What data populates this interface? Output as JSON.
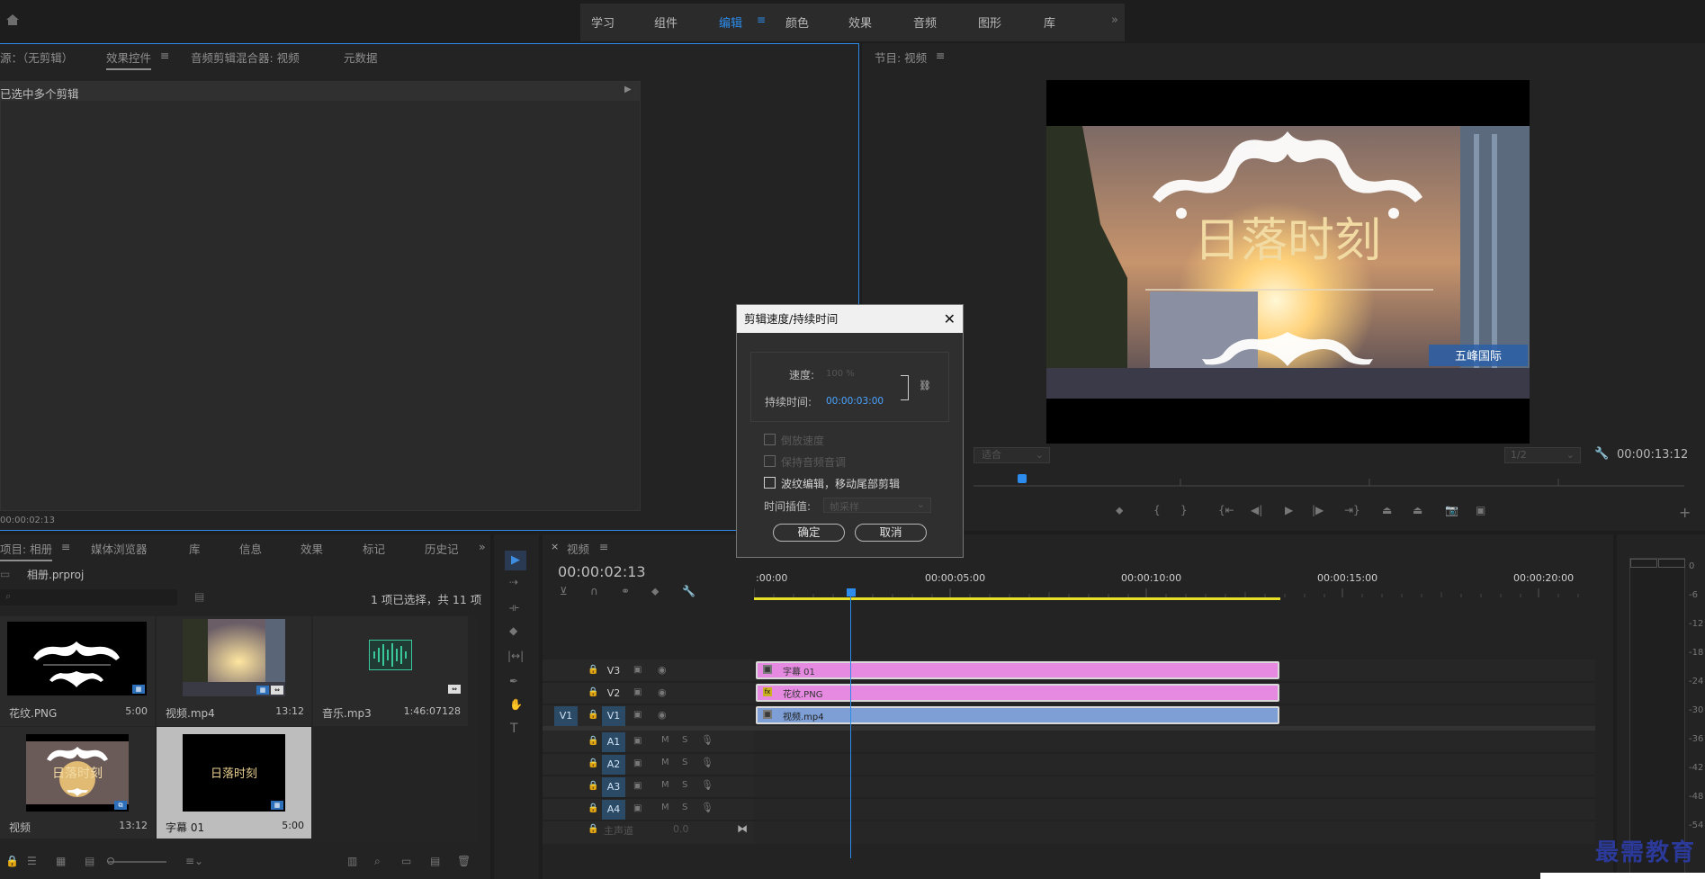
{
  "workspaces": [
    "学习",
    "组件",
    "编辑",
    "颜色",
    "效果",
    "音频",
    "图形",
    "库"
  ],
  "workspace_active_index": 2,
  "source_panel": {
    "tabs": [
      "源：（无剪辑）",
      "效果控件",
      "音频剪辑混合器: 视频",
      "元数据"
    ],
    "selected_message": "已选中多个剪辑",
    "timecode": "00:00:02:13"
  },
  "program_monitor": {
    "tab": "节目: 视频",
    "fit_label": "适合",
    "resolution": "1/2",
    "timecode": "00:00:13:12",
    "title_text": "日落时刻",
    "sign_text": "五峰国际"
  },
  "project_panel": {
    "tabs": [
      "项目: 相册",
      "媒体浏览器",
      "库",
      "信息",
      "效果",
      "标记",
      "历史记"
    ],
    "project_file": "相册.prproj",
    "selection_info": "1 项已选择，共 11 项",
    "items": [
      {
        "name": "花纹.PNG",
        "duration": "5:00",
        "thumb": "ornament"
      },
      {
        "name": "视频.mp4",
        "duration": "13:12",
        "thumb": "sunset"
      },
      {
        "name": "音乐.mp3",
        "duration": "1:46:07128",
        "thumb": "audio"
      },
      {
        "name": "视频",
        "duration": "13:12",
        "thumb": "sequence"
      },
      {
        "name": "字幕 01",
        "duration": "5:00",
        "thumb": "caption"
      }
    ],
    "caption_thumb_text": "日落时刻",
    "sequence_thumb_text": "日落时刻"
  },
  "timeline": {
    "tab": "视频",
    "timecode": "00:00:02:13",
    "ruler": [
      ":00:00",
      "00:00:05:00",
      "00:00:10:00",
      "00:00:15:00",
      "00:00:20:00"
    ],
    "video_tracks": [
      "V3",
      "V2",
      "V1"
    ],
    "audio_tracks": [
      "A1",
      "A2",
      "A3",
      "A4"
    ],
    "source_patch": "V1",
    "master": "主声道",
    "master_value": "0.0",
    "mute_label": "M",
    "solo_label": "S",
    "clips": [
      {
        "track": "V3",
        "name": "字幕 01",
        "color": "#e58ae0"
      },
      {
        "track": "V2",
        "name": "花纹.PNG",
        "color": "#e58ae0"
      },
      {
        "track": "V1",
        "name": "视频.mp4",
        "color": "#7d9fd6"
      }
    ]
  },
  "meter_labels": [
    "0",
    "-6",
    "-12",
    "-18",
    "-24",
    "-30",
    "-36",
    "-42",
    "-48",
    "-54"
  ],
  "dialog": {
    "title": "剪辑速度/持续时间",
    "speed_label": "速度:",
    "speed_value": "100 %",
    "duration_label": "持续时间:",
    "duration_value": "00:00:03:00",
    "reverse": "倒放速度",
    "pitch": "保持音频音调",
    "ripple": "波纹编辑，移动尾部剪辑",
    "interp_label": "时间插值:",
    "interp_value": "帧采样",
    "ok": "确定",
    "cancel": "取消"
  },
  "watermark": "最需教育"
}
